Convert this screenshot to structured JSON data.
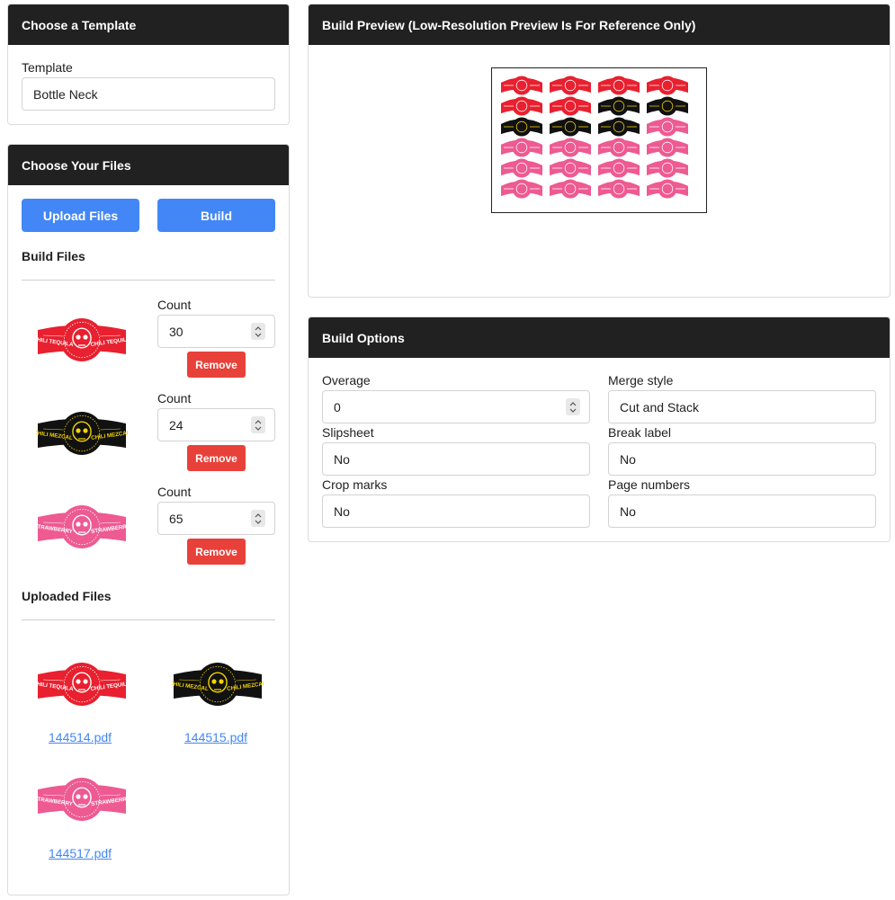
{
  "template_card": {
    "title": "Choose a Template",
    "label": "Template",
    "value": "Bottle Neck"
  },
  "files_card": {
    "title": "Choose Your Files",
    "upload_label": "Upload Files",
    "build_label": "Build",
    "build_files_title": "Build Files",
    "uploaded_files_title": "Uploaded Files",
    "build_files": [
      {
        "count_label": "Count",
        "count": "30",
        "remove_label": "Remove",
        "thumb": {
          "bg": "#e8202f",
          "ink": "#ffffff",
          "text": "CHILI TEQUILA"
        }
      },
      {
        "count_label": "Count",
        "count": "24",
        "remove_label": "Remove",
        "thumb": {
          "bg": "#111111",
          "ink": "#f2d400",
          "text": "CHILI MEZCAL"
        }
      },
      {
        "count_label": "Count",
        "count": "65",
        "remove_label": "Remove",
        "thumb": {
          "bg": "#ee5a92",
          "ink": "#ffffff",
          "text": "STRAWBERRY"
        }
      }
    ],
    "uploaded_files": [
      {
        "name": "144514.pdf",
        "thumb": {
          "bg": "#e8202f",
          "ink": "#ffffff",
          "text": "CHILI TEQUILA"
        }
      },
      {
        "name": "144515.pdf",
        "thumb": {
          "bg": "#111111",
          "ink": "#f2d400",
          "text": "CHILI MEZCAL"
        }
      },
      {
        "name": "144517.pdf",
        "thumb": {
          "bg": "#ee5a92",
          "ink": "#ffffff",
          "text": "STRAWBERRY"
        }
      }
    ]
  },
  "preview_card": {
    "title": "Build Preview (Low-Resolution Preview Is For Reference Only)",
    "grid": [
      [
        "red",
        "red",
        "red",
        "red"
      ],
      [
        "red",
        "red",
        "black",
        "black"
      ],
      [
        "black",
        "black",
        "black",
        "pink"
      ],
      [
        "pink",
        "pink",
        "pink",
        "pink"
      ],
      [
        "pink",
        "pink",
        "pink",
        "pink"
      ],
      [
        "pink",
        "pink",
        "pink",
        "pink"
      ]
    ],
    "colors": {
      "red": "#e8202f",
      "black": "#111111",
      "pink": "#ee5a92"
    }
  },
  "options_card": {
    "title": "Build Options",
    "overage_label": "Overage",
    "overage_value": "0",
    "merge_label": "Merge style",
    "merge_value": "Cut and Stack",
    "slipsheet_label": "Slipsheet",
    "slipsheet_value": "No",
    "break_label": "Break label",
    "break_value": "No",
    "crop_label": "Crop marks",
    "crop_value": "No",
    "page_numbers_label": "Page numbers",
    "page_numbers_value": "No"
  },
  "colors": {
    "header_bg": "#212121",
    "accent_blue": "#4287f5",
    "danger_red": "#e8413a"
  }
}
